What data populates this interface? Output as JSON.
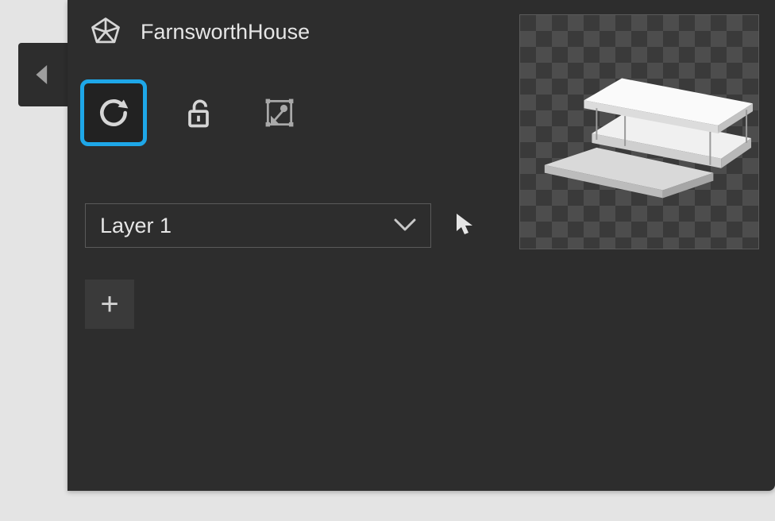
{
  "header": {
    "title": "FarnsworthHouse"
  },
  "tools": {
    "refresh_selected": true
  },
  "layer": {
    "selected_label": "Layer 1"
  },
  "add_button_label": "+"
}
